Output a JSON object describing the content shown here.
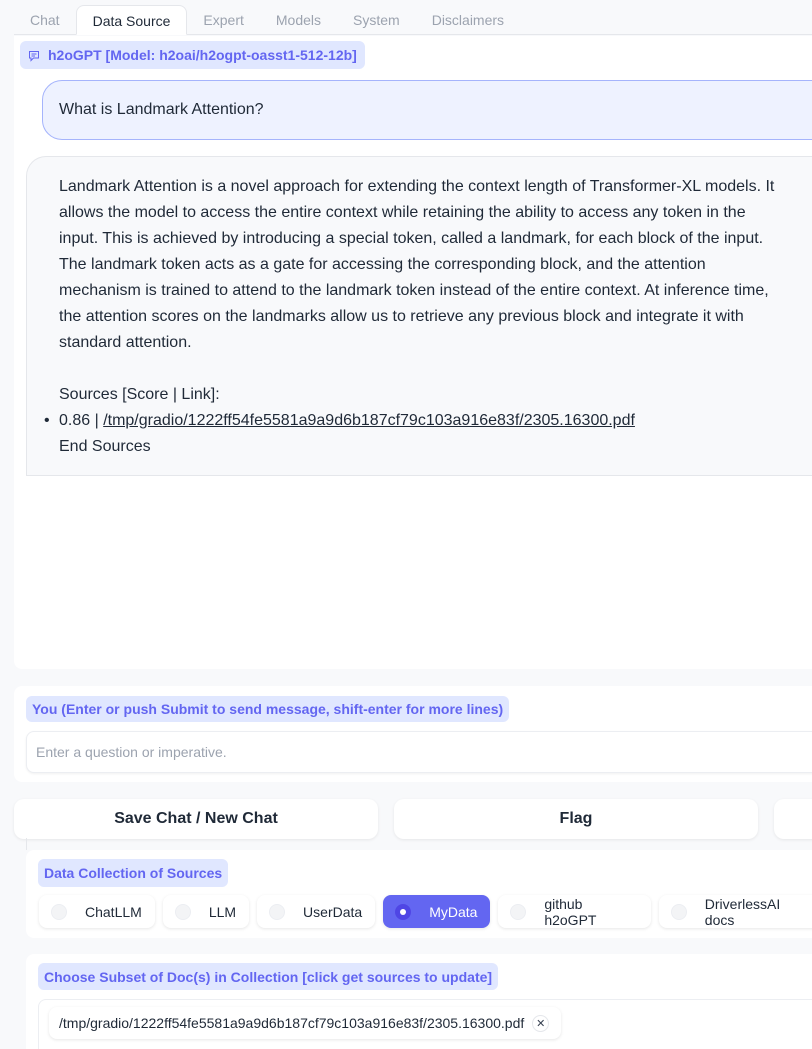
{
  "tabs": [
    {
      "label": "Chat",
      "active": false
    },
    {
      "label": "Data Source",
      "active": true
    },
    {
      "label": "Expert",
      "active": false
    },
    {
      "label": "Models",
      "active": false
    },
    {
      "label": "System",
      "active": false
    },
    {
      "label": "Disclaimers",
      "active": false
    }
  ],
  "chat": {
    "label": "h2oGPT [Model: h2oai/h2ogpt-oasst1-512-12b]",
    "label_icon": "chat-bubble-icon",
    "user_message": "What is Landmark Attention?",
    "bot_message": {
      "paragraph": "Landmark Attention is a novel approach for extending the context length of Transformer-XL models. It allows the model to access the entire context while retaining the ability to access any token in the input. This is achieved by introducing a special token, called a landmark, for each block of the input. The landmark token acts as a gate for accessing the corresponding block, and the attention mechanism is trained to attend to the landmark token instead of the entire context. At inference time, the attention scores on the landmarks allow us to retrieve any previous block and integrate it with standard attention.",
      "sources_header": "Sources [Score | Link]:",
      "sources": [
        {
          "score": "0.86",
          "separator": " | ",
          "link": "/tmp/gradio/1222ff54fe5581a9a9d6b187cf79c103a916e83f/2305.16300.pdf"
        }
      ],
      "sources_footer": "End Sources"
    }
  },
  "input": {
    "label": "You (Enter or push Submit to send message, shift-enter for more lines)",
    "value": "",
    "placeholder": "Enter a question or imperative."
  },
  "buttons": {
    "save": "Save Chat / New Chat",
    "flag": "Flag",
    "third": ""
  },
  "collection": {
    "label": "Data Collection of Sources",
    "selected": "MyData",
    "options": [
      "ChatLLM",
      "LLM",
      "UserData",
      "MyData",
      "github h2oGPT",
      "DriverlessAI docs"
    ]
  },
  "subset": {
    "label": "Choose Subset of Doc(s) in Collection [click get sources to update]",
    "chips": [
      "/tmp/gradio/1222ff54fe5581a9a9d6b187cf79c103a916e83f/2305.16300.pdf"
    ],
    "remove_icon": "close-icon"
  }
}
